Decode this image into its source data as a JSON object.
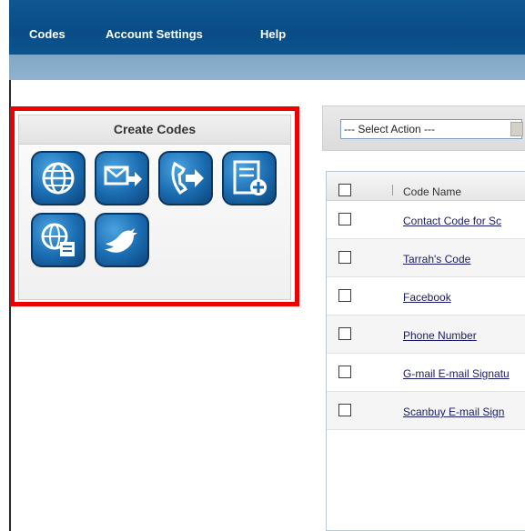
{
  "nav": {
    "items": [
      {
        "label": "Codes"
      },
      {
        "label": "Account Settings"
      },
      {
        "label": "Help"
      }
    ]
  },
  "create_panel": {
    "title": "Create Codes",
    "icons": [
      {
        "name": "web-url-code-icon"
      },
      {
        "name": "email-code-icon"
      },
      {
        "name": "phone-code-icon"
      },
      {
        "name": "contact-card-code-icon"
      },
      {
        "name": "web-page-code-icon"
      },
      {
        "name": "twitter-code-icon"
      }
    ]
  },
  "action_bar": {
    "select_value": "--- Select Action ---"
  },
  "table": {
    "header": "Code Name",
    "rows": [
      {
        "name": "Contact Code for Sc"
      },
      {
        "name": "Tarrah's Code"
      },
      {
        "name": "Facebook"
      },
      {
        "name": "Phone Number"
      },
      {
        "name": "G-mail E-mail Signatu"
      },
      {
        "name": "Scanbuy E-mail Sign"
      }
    ]
  },
  "colors": {
    "nav_bg": "#0a4c85",
    "subbar_bg": "#8fb3cf",
    "highlight": "#ee0000",
    "icon_blue": "#1a6bb0"
  }
}
